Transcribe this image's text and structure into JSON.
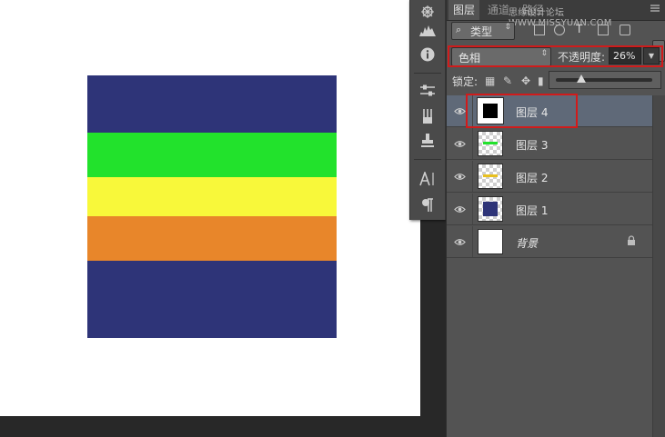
{
  "panel": {
    "tabs": [
      "图层",
      "通道",
      "路径"
    ],
    "active_tab": 0,
    "watermark": "思缘设计论坛 WWW.MISSYUAN.COM"
  },
  "filter": {
    "label": "类型",
    "icon": "search-icon"
  },
  "blend": {
    "mode": "色相",
    "opacity_label": "不透明度:",
    "opacity_value": "26%",
    "opacity_fraction": 0.26
  },
  "lock": {
    "label": "锁定:"
  },
  "layers": [
    {
      "name": "图层 4",
      "visible": true,
      "selected": true,
      "thumb_color": "#000000",
      "thumb_kind": "solid"
    },
    {
      "name": "图层 3",
      "visible": true,
      "selected": false,
      "thumb_color": "#22e22c",
      "thumb_kind": "stripe"
    },
    {
      "name": "图层 2",
      "visible": true,
      "selected": false,
      "thumb_color": "#e8c020",
      "thumb_kind": "stripe"
    },
    {
      "name": "图层 1",
      "visible": true,
      "selected": false,
      "thumb_color": "#2e3478",
      "thumb_kind": "block"
    },
    {
      "name": "背景",
      "visible": true,
      "selected": false,
      "thumb_color": "#ffffff",
      "thumb_kind": "background",
      "locked": true
    }
  ],
  "artwork": {
    "stripes": [
      {
        "color": "#2e3478",
        "fraction": 0.217
      },
      {
        "color": "#22e22c",
        "fraction": 0.17
      },
      {
        "color": "#f8f83a",
        "fraction": 0.149
      },
      {
        "color": "#e8862a",
        "fraction": 0.17
      },
      {
        "color": "#2e3478",
        "fraction": 0.294
      }
    ]
  },
  "tools": [
    "compass-icon",
    "histogram-icon",
    "info-icon",
    "adjust-icon",
    "brush-preset-icon",
    "clone-source-icon",
    "character-icon",
    "paragraph-icon"
  ]
}
